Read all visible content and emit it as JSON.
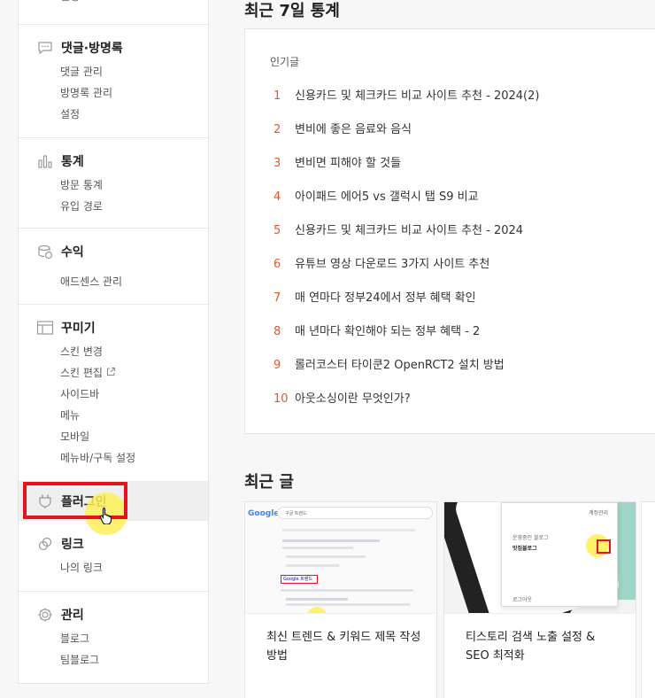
{
  "sidebar": {
    "top_cut": "설정",
    "comments": {
      "title": "댓글·방명록",
      "items": [
        "댓글 관리",
        "방명록 관리",
        "설정"
      ]
    },
    "stats": {
      "title": "통계",
      "items": [
        "방문 통계",
        "유입 경로"
      ]
    },
    "revenue": {
      "title": "수익",
      "items": [
        "애드센스 관리"
      ]
    },
    "design": {
      "title": "꾸미기",
      "items": [
        "스킨 변경",
        "스킨 편집",
        "사이드바",
        "메뉴",
        "모바일",
        "메뉴바/구독 설정"
      ]
    },
    "plugin": {
      "title": "플러그인"
    },
    "link": {
      "title": "링크",
      "items": [
        "나의 링크"
      ]
    },
    "manage": {
      "title": "관리",
      "items": [
        "블로그",
        "팀블로그"
      ]
    }
  },
  "stats_section": {
    "title": "최근 7일 통계",
    "panel_label": "인기글",
    "popular": [
      {
        "rank": "1",
        "title": "신용카드 및 체크카드 비교 사이트 추천 - 2024(2)"
      },
      {
        "rank": "2",
        "title": "변비에 좋은 음료와 음식"
      },
      {
        "rank": "3",
        "title": "변비면 피해야 할 것들"
      },
      {
        "rank": "4",
        "title": "아이패드 에어5 vs 갤럭시 탭 S9 비교"
      },
      {
        "rank": "5",
        "title": "신용카드 및 체크카드 비교 사이트 추천 - 2024"
      },
      {
        "rank": "6",
        "title": "유튜브 영상 다운로드 3가지 사이트 추천"
      },
      {
        "rank": "7",
        "title": "매 연마다 정부24에서 정부 혜택 확인"
      },
      {
        "rank": "8",
        "title": "매 년마다 확인해야 되는 정부 혜택 - 2"
      },
      {
        "rank": "9",
        "title": "롤러코스터 타이쿤2 OpenRCT2 설치 방법"
      },
      {
        "rank": "10",
        "title": "아웃소싱이란 무엇인가?"
      }
    ]
  },
  "recent_section": {
    "title": "최근 글",
    "cards": [
      {
        "title": "최신 트렌드 & 키워드 제목 작성 방법",
        "thumb": {
          "logo": "Google",
          "query": "구글 트렌드",
          "result": "Google 트렌드"
        }
      },
      {
        "title": "티스토리 검색 노출 설정 & SEO 최적화",
        "thumb": {
          "menu_top": "계정관리",
          "menu_label": "운영중인 블로그",
          "menu_blog": "맛집블로그",
          "menu_logout": "로그아웃"
        }
      }
    ]
  },
  "colors": {
    "rank": "#e4572e",
    "highlight": "#e5131d",
    "cursor_glow": "#fff05a"
  },
  "icons": {
    "comments": "speech-bubble-icon",
    "stats": "bar-chart-icon",
    "revenue": "coins-icon",
    "design": "layout-icon",
    "plugin": "plug-icon",
    "link": "link-icon",
    "manage": "gear-icon",
    "external": "external-link-icon",
    "cursor": "hand-pointer-icon"
  }
}
